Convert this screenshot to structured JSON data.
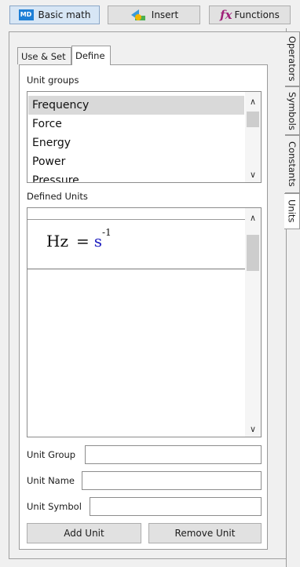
{
  "toolbar": {
    "basic_math": {
      "badge": "MD",
      "label": "Basic math"
    },
    "insert": {
      "label": "Insert"
    },
    "functions": {
      "glyph": "fx",
      "label": "Functions"
    }
  },
  "side_tabs": [
    {
      "label": "Operators"
    },
    {
      "label": "Symbols"
    },
    {
      "label": "Constants"
    },
    {
      "label": "Units"
    }
  ],
  "inner_tabs": [
    {
      "label": "Use & Set"
    },
    {
      "label": "Define"
    }
  ],
  "unit_groups": {
    "label": "Unit groups",
    "items": [
      "Frequency",
      "Force",
      "Energy",
      "Power",
      "Pressure"
    ],
    "selected": "Frequency"
  },
  "defined_units": {
    "label": "Defined Units",
    "formula": {
      "lhs": "Hz",
      "eq": "=",
      "unit": "s",
      "exponent": "-1"
    }
  },
  "form": {
    "unit_group_label": "Unit Group",
    "unit_group_value": "",
    "unit_name_label": "Unit Name",
    "unit_name_value": "",
    "unit_symbol_label": "Unit Symbol",
    "unit_symbol_value": ""
  },
  "buttons": {
    "add_unit": "Add Unit",
    "remove_unit": "Remove Unit"
  },
  "colors": {
    "selection": "#d9d9d9",
    "unit_blue": "#2020c0",
    "md_badge": "#1e7fd6"
  }
}
